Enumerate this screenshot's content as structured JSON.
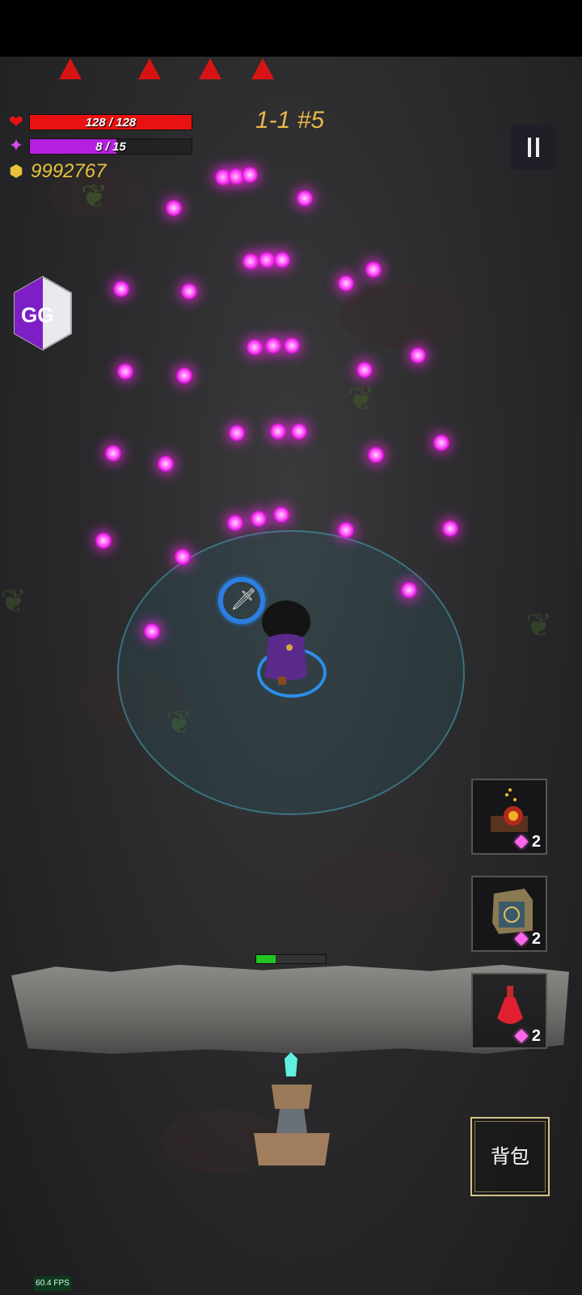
{
  "hud": {
    "hp_text": "128 / 128",
    "hp_fraction": 1.0,
    "mana_text": "8 / 15",
    "mana_fraction": 0.533,
    "gold": "9992767",
    "level": "1-1 #5"
  },
  "skills": [
    {
      "icon": "potion-flask-fire-icon",
      "cost": "2"
    },
    {
      "icon": "rune-crate-icon",
      "cost": "2"
    },
    {
      "icon": "red-health-potion-icon",
      "cost": "2"
    }
  ],
  "wall": {
    "health_fraction": 0.28
  },
  "bag_label": "背包",
  "fps": "60.4 FPS",
  "gg_logo": "GG",
  "colors": {
    "hp": "#e81212",
    "mana": "#b71fe0",
    "orb": "#ff4df7",
    "gold": "#e8c23b",
    "warning": "#d71414"
  }
}
